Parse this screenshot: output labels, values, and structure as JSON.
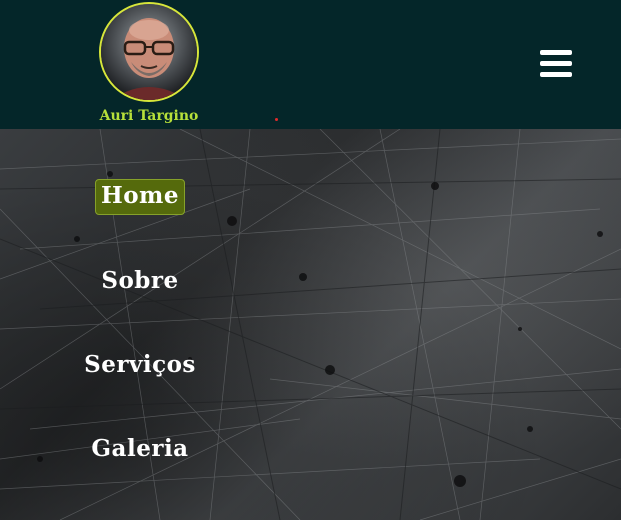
{
  "header": {
    "brand_name": "Auri Targino",
    "avatar_icon": "user-avatar-photo",
    "menu_icon": "hamburger-menu-icon"
  },
  "nav": {
    "items": [
      {
        "label": "Home",
        "active": true
      },
      {
        "label": "Sobre",
        "active": false
      },
      {
        "label": "Serviços",
        "active": false
      },
      {
        "label": "Galeria",
        "active": false
      }
    ]
  },
  "colors": {
    "header_bg": "#042629",
    "brand_name": "#b7e03a",
    "active_nav_bg": "#556a0c",
    "avatar_border": "#d7e63a"
  }
}
